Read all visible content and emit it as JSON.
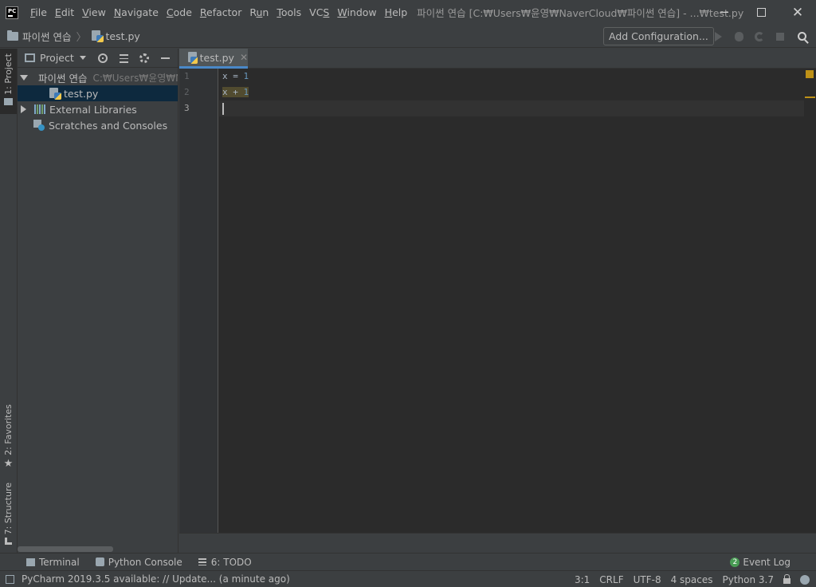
{
  "window": {
    "title": "파이썬 연습 [C:₩Users₩윤영₩NaverCloud₩파이썬 연습] - ...₩test.py"
  },
  "menu": [
    {
      "label": "File",
      "mnemonic": "F"
    },
    {
      "label": "Edit",
      "mnemonic": "E"
    },
    {
      "label": "View",
      "mnemonic": "V"
    },
    {
      "label": "Navigate",
      "mnemonic": "N"
    },
    {
      "label": "Code",
      "mnemonic": "C"
    },
    {
      "label": "Refactor",
      "mnemonic": "R"
    },
    {
      "label": "Run",
      "mnemonic": "u"
    },
    {
      "label": "Tools",
      "mnemonic": "T"
    },
    {
      "label": "VCS",
      "mnemonic": "S"
    },
    {
      "label": "Window",
      "mnemonic": "W"
    },
    {
      "label": "Help",
      "mnemonic": "H"
    }
  ],
  "breadcrumb": {
    "project": "파이썬 연습",
    "file": "test.py"
  },
  "navbar": {
    "add_configuration": "Add Configuration..."
  },
  "left_strip": {
    "project": "1: Project",
    "favorites": "2: Favorites",
    "structure": "7: Structure"
  },
  "project_panel": {
    "title": "Project",
    "tree": {
      "root_name": "파이썬 연습",
      "root_path": "C:₩Users₩윤영₩N",
      "file": "test.py",
      "external_libraries": "External Libraries",
      "scratches": "Scratches and Consoles"
    }
  },
  "editor": {
    "tab_label": "test.py",
    "line_numbers": [
      "1",
      "2",
      "3"
    ],
    "lines": [
      {
        "text": "x = ",
        "num": "1"
      },
      {
        "text": "x + ",
        "num": "1"
      },
      {
        "text": "",
        "num": ""
      }
    ]
  },
  "bottom_tools": {
    "terminal": "Terminal",
    "python_console": "Python Console",
    "todo": "6: TODO",
    "event_log": "Event Log",
    "event_count": "2"
  },
  "status": {
    "message": "PyCharm 2019.3.5 available: // Update... (a minute ago)",
    "position": "3:1",
    "line_sep": "CRLF",
    "encoding": "UTF-8",
    "indent": "4 spaces",
    "interpreter": "Python 3.7"
  },
  "colors": {
    "accent": "#4a88c7",
    "warning": "#be9117",
    "selection": "#0d293e",
    "number": "#6897bb"
  }
}
